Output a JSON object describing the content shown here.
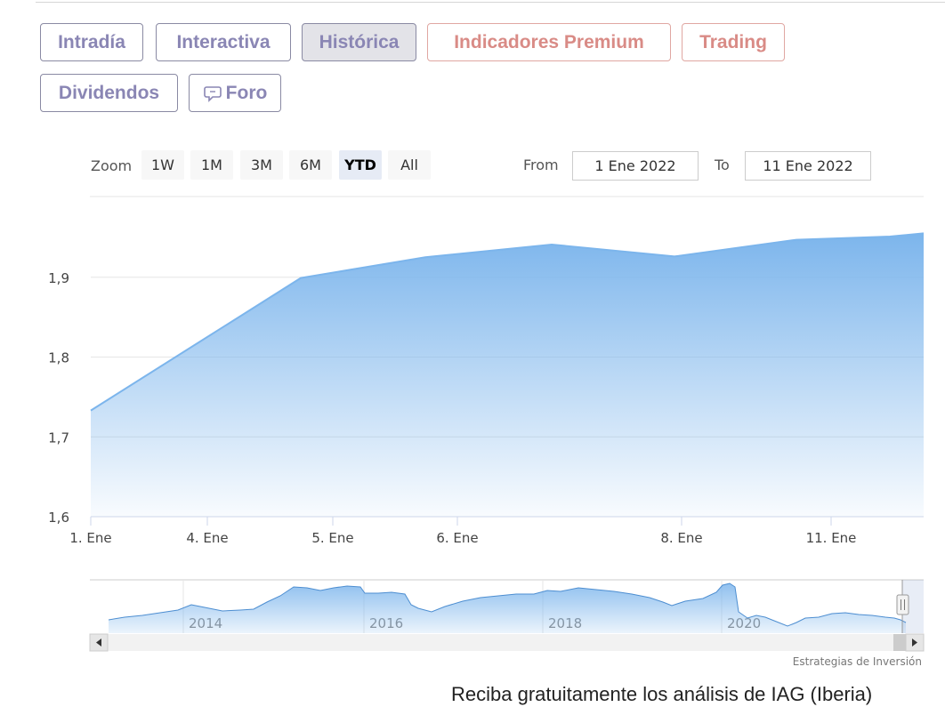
{
  "tabs": [
    {
      "label": "Intradía",
      "state": "normal"
    },
    {
      "label": "Interactiva",
      "state": "normal"
    },
    {
      "label": "Histórica",
      "state": "active"
    },
    {
      "label": "Indicadores Premium",
      "state": "premium"
    },
    {
      "label": "Trading",
      "state": "premium"
    },
    {
      "label": "Dividendos",
      "state": "normal"
    },
    {
      "label": "Foro",
      "state": "normal",
      "icon": "speech-bubble-icon"
    }
  ],
  "range_selector": {
    "zoom_label": "Zoom",
    "buttons": [
      "1W",
      "1M",
      "3M",
      "6M",
      "YTD",
      "All"
    ],
    "selected": "YTD",
    "from_label": "From",
    "from_value": "1 Ene 2022",
    "to_label": "To",
    "to_value": "11 Ene 2022"
  },
  "colors": {
    "series_line": "#7cb5ec",
    "tab_text": "#8a86b4",
    "premium_text": "#d98b86"
  },
  "chart_data": {
    "type": "area",
    "title": "",
    "xlabel": "",
    "ylabel": "",
    "x_tick_labels": [
      "1. Ene",
      "4. Ene",
      "5. Ene",
      "6. Ene",
      "8. Ene",
      "11. Ene"
    ],
    "y_tick_labels": [
      "1,6",
      "1,7",
      "1,8",
      "1,9"
    ],
    "ylim": [
      1.6,
      2.0
    ],
    "x": [
      "2022-01-03",
      "2022-01-04",
      "2022-01-05",
      "2022-01-06",
      "2022-01-07",
      "2022-01-08",
      "2022-01-10",
      "2022-01-11"
    ],
    "series": [
      {
        "values": [
          1.733,
          1.899,
          1.925,
          1.941,
          1.926,
          1.947,
          1.951,
          1.955
        ]
      }
    ],
    "grid": "horizontal",
    "navigator": {
      "x_tick_labels": [
        "2014",
        "2016",
        "2018",
        "2020"
      ]
    },
    "credit": "Estrategias de Inversión"
  },
  "footer": {
    "text": "Reciba gratuitamente los análisis de IAG (Iberia)"
  }
}
